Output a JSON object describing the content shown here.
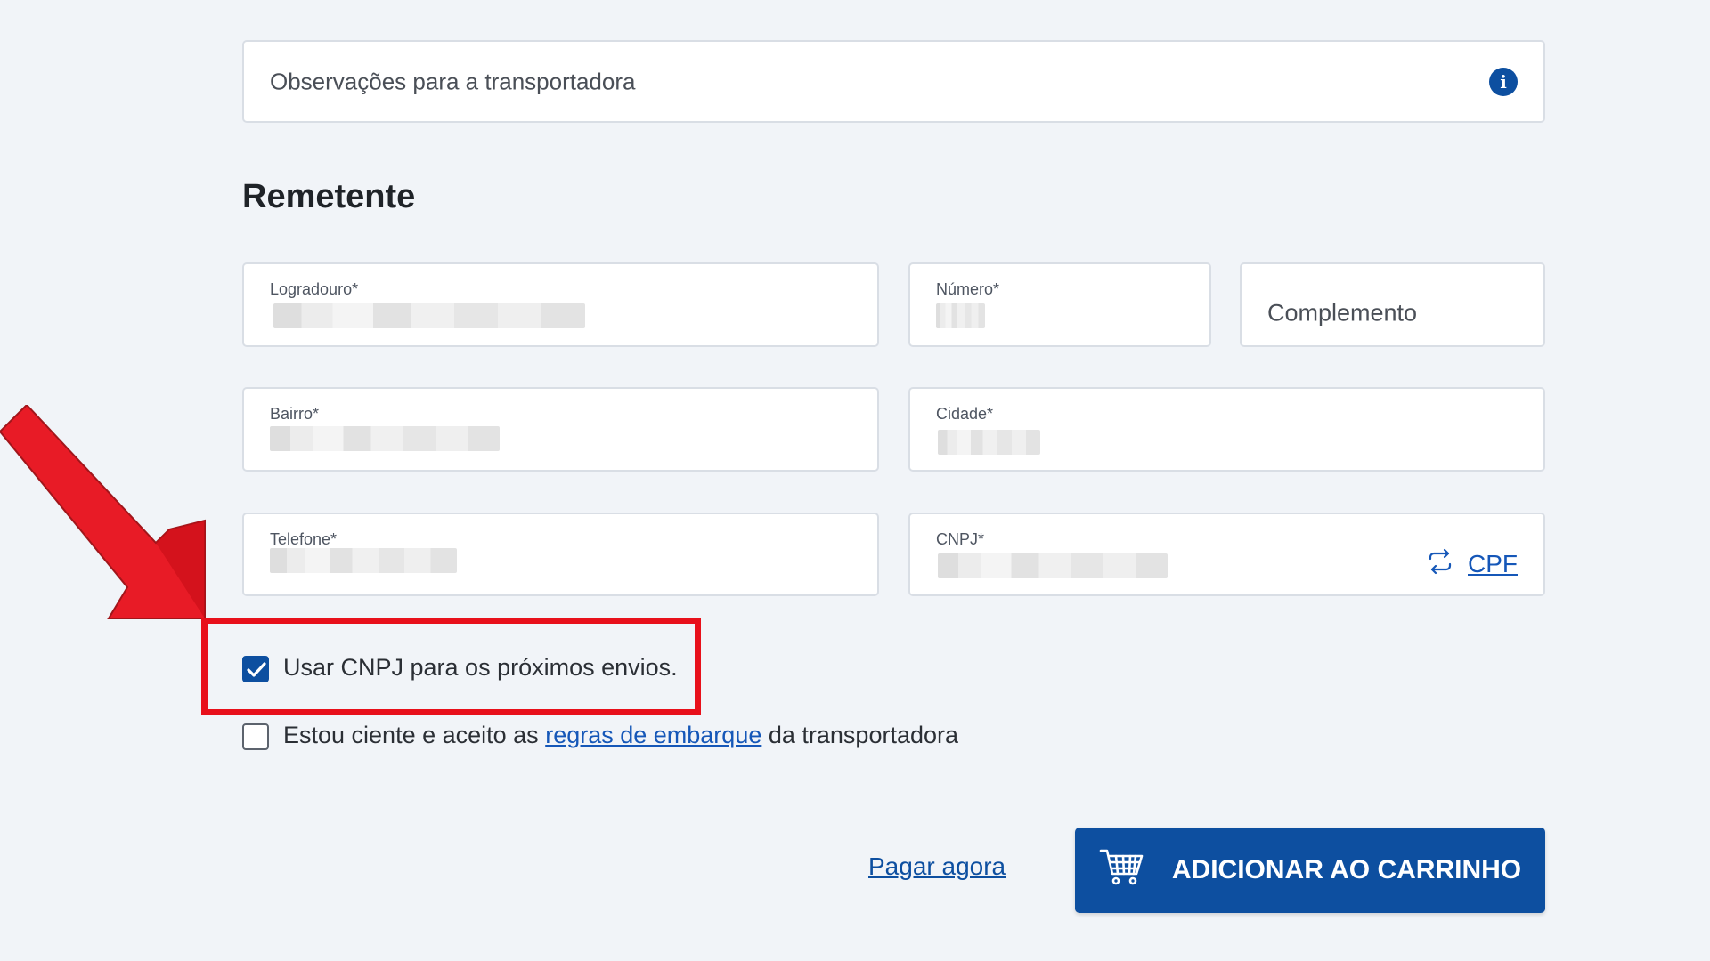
{
  "shipping_notes": {
    "placeholder": "Observações para a transportadora",
    "info_icon": "info-icon"
  },
  "section": {
    "title": "Remetente"
  },
  "fields": {
    "logradouro": {
      "label": "Logradouro*"
    },
    "numero": {
      "label": "Número*"
    },
    "complemento": {
      "placeholder": "Complemento"
    },
    "bairro": {
      "label": "Bairro*"
    },
    "cidade": {
      "label": "Cidade*"
    },
    "telefone": {
      "label": "Telefone*"
    },
    "cnpj": {
      "label": "CNPJ*",
      "toggle_label": "CPF",
      "toggle_icon": "swap-icon"
    }
  },
  "checkboxes": {
    "use_cnpj": {
      "label": "Usar CNPJ para os próximos envios.",
      "checked": true
    },
    "accept_rules": {
      "label_before": "Estou ciente e aceito as",
      "link_text": "regras de embarque",
      "label_after": "da transportadora",
      "checked": false
    }
  },
  "actions": {
    "pay_now": "Pagar agora",
    "add_to_cart": "ADICIONAR AO CARRINHO",
    "cart_icon": "cart-icon"
  },
  "colors": {
    "primary": "#0d4fa0",
    "link": "#1557b8",
    "highlight": "#e8101b"
  }
}
